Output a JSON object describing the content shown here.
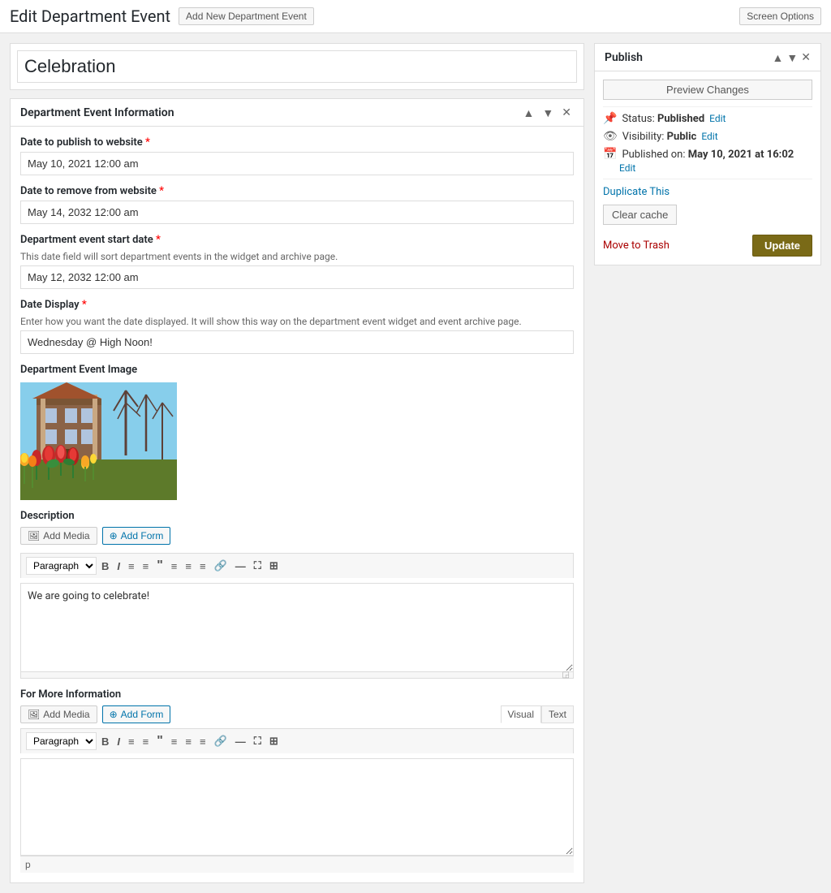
{
  "header": {
    "page_title": "Edit Department Event",
    "add_new_label": "Add New Department Event",
    "screen_options_label": "Screen Options"
  },
  "post": {
    "title": "Celebration"
  },
  "metabox": {
    "title": "Department Event Information",
    "fields": {
      "publish_date_label": "Date to publish to website",
      "publish_date_value": "May 10, 2021 12:00 am",
      "remove_date_label": "Date to remove from website",
      "remove_date_value": "May 14, 2032 12:00 am",
      "start_date_label": "Department event start date",
      "start_date_hint": "This date field will sort department events in the widget and archive page.",
      "start_date_value": "May 12, 2032 12:00 am",
      "date_display_label": "Date Display",
      "date_display_hint": "Enter how you want the date displayed. It will show this way on the department event widget and event archive page.",
      "date_display_value": "Wednesday @ High Noon!",
      "image_section_label": "Department Event Image",
      "description_label": "Description",
      "description_content": "We are going to celebrate!",
      "for_more_info_label": "For More Information"
    }
  },
  "toolbar": {
    "paragraph_label": "Paragraph",
    "bold_label": "B",
    "italic_label": "I",
    "unordered_list_label": "≡",
    "ordered_list_label": "≡",
    "blockquote_label": "\"",
    "align_left_label": "≡",
    "align_center_label": "≡",
    "align_right_label": "≡",
    "link_label": "🔗",
    "more_label": "—",
    "fullscreen_label": "⛶",
    "grid_label": "⊞",
    "add_media_label": "Add Media",
    "add_form_label": "Add Form"
  },
  "for_more_info_toolbar": {
    "visual_tab": "Visual",
    "text_tab": "Text"
  },
  "publish_box": {
    "title": "Publish",
    "preview_changes_label": "Preview Changes",
    "status_label": "Status:",
    "status_value": "Published",
    "status_edit_label": "Edit",
    "visibility_label": "Visibility:",
    "visibility_value": "Public",
    "visibility_edit_label": "Edit",
    "published_on_label": "Published on:",
    "published_on_value": "May 10, 2021 at 16:02",
    "published_on_edit_label": "Edit",
    "duplicate_label": "Duplicate This",
    "clear_cache_label": "Clear cache",
    "move_to_trash_label": "Move to Trash",
    "update_label": "Update"
  },
  "footer": {
    "p_tag": "p"
  }
}
